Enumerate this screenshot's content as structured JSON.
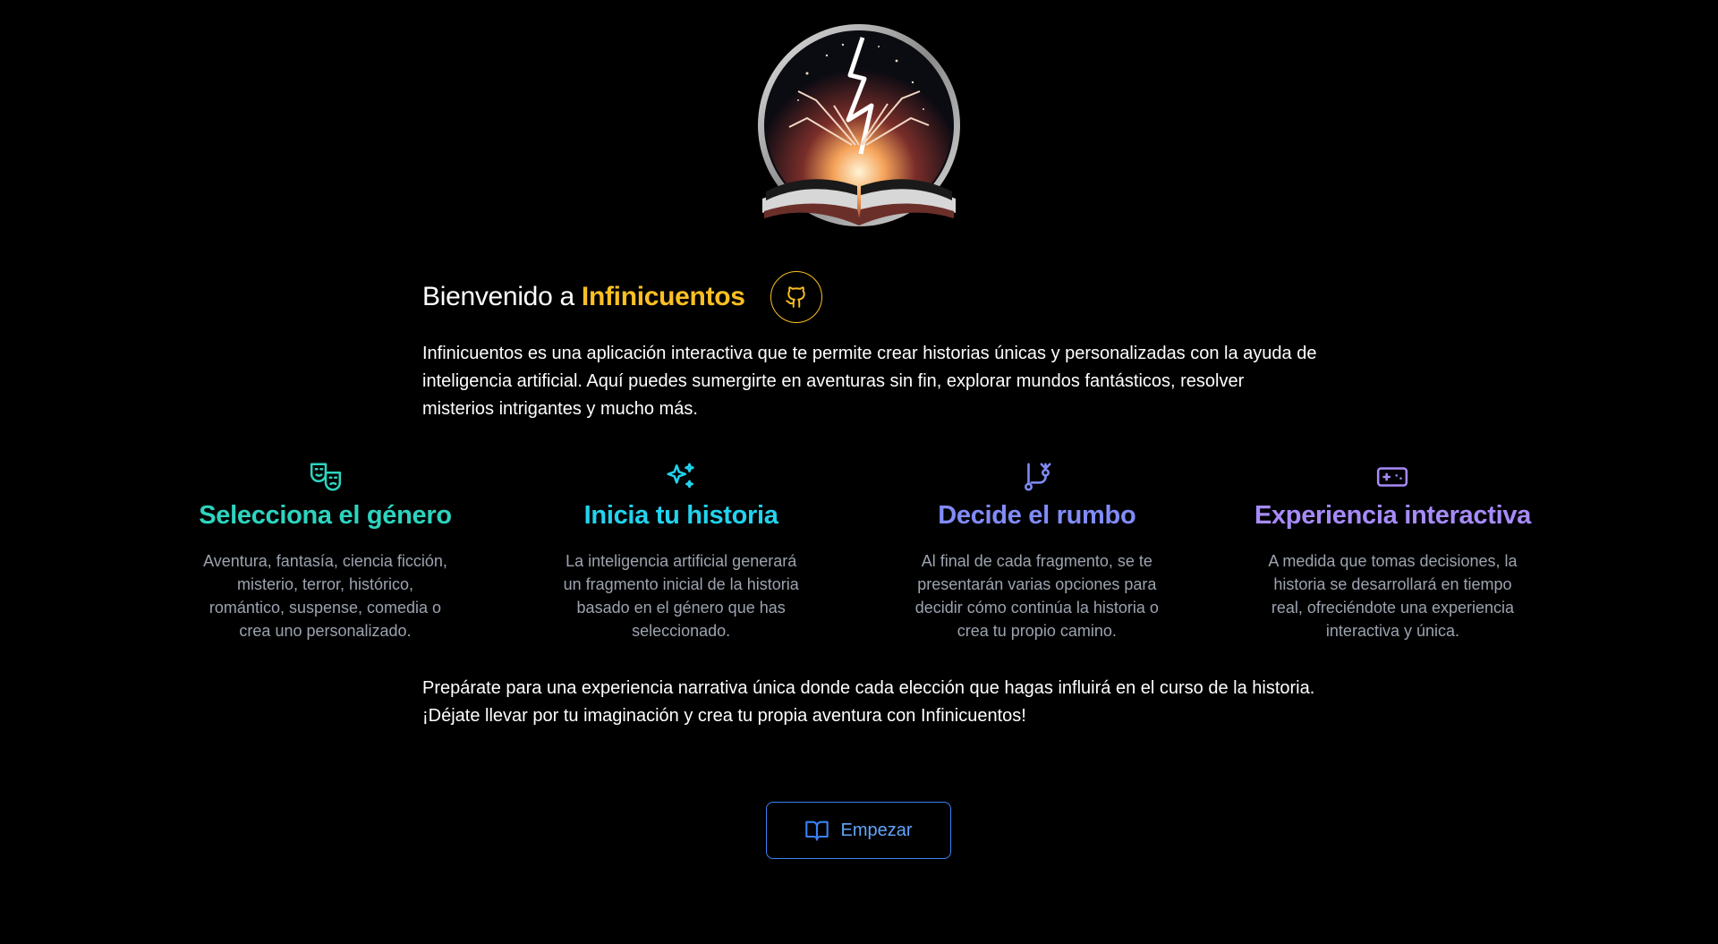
{
  "logo": {
    "icon": "book-lightning-logo"
  },
  "header": {
    "welcome_prefix": "Bienvenido a ",
    "brand": "Infinicuentos",
    "github_icon": "github-icon",
    "accent_color": "#fbbf24"
  },
  "intro": "Infinicuentos es una aplicación interactiva que te permite crear historias únicas y personalizadas con la ayuda de inteligencia artificial. Aquí puedes sumergirte en aventuras sin fin, explorar mundos fantásticos, resolver misterios intrigantes y mucho más.",
  "features": [
    {
      "icon": "theater-masks-icon",
      "title": "Selecciona el género",
      "description": "Aventura, fantasía, ciencia ficción, misterio, terror, histórico, romántico, suspense, comedia o crea uno personalizado.",
      "color": "#2dd4bf"
    },
    {
      "icon": "sparkles-icon",
      "title": "Inicia tu historia",
      "description": "La inteligencia artificial generará un fragmento inicial de la historia basado en el género que has seleccionado.",
      "color": "#22d3ee"
    },
    {
      "icon": "git-branch-icon",
      "title": "Decide el rumbo",
      "description": "Al final de cada fragmento, se te presentarán varias opciones para decidir cómo continúa la historia o crea tu propio camino.",
      "color": "#818cf8"
    },
    {
      "icon": "gamepad-icon",
      "title": "Experiencia interactiva",
      "description": "A medida que tomas decisiones, la historia se desarrollará en tiempo real, ofreciéndote una experiencia interactiva y única.",
      "color": "#a78bfa"
    }
  ],
  "outro": "Prepárate para una experiencia narrativa única donde cada elección que hagas influirá en el curso de la historia. ¡Déjate llevar por tu imaginación y crea tu propia aventura con Infinicuentos!",
  "start_button": {
    "label": "Empezar",
    "icon": "open-book-icon",
    "color": "#3b82f6"
  }
}
